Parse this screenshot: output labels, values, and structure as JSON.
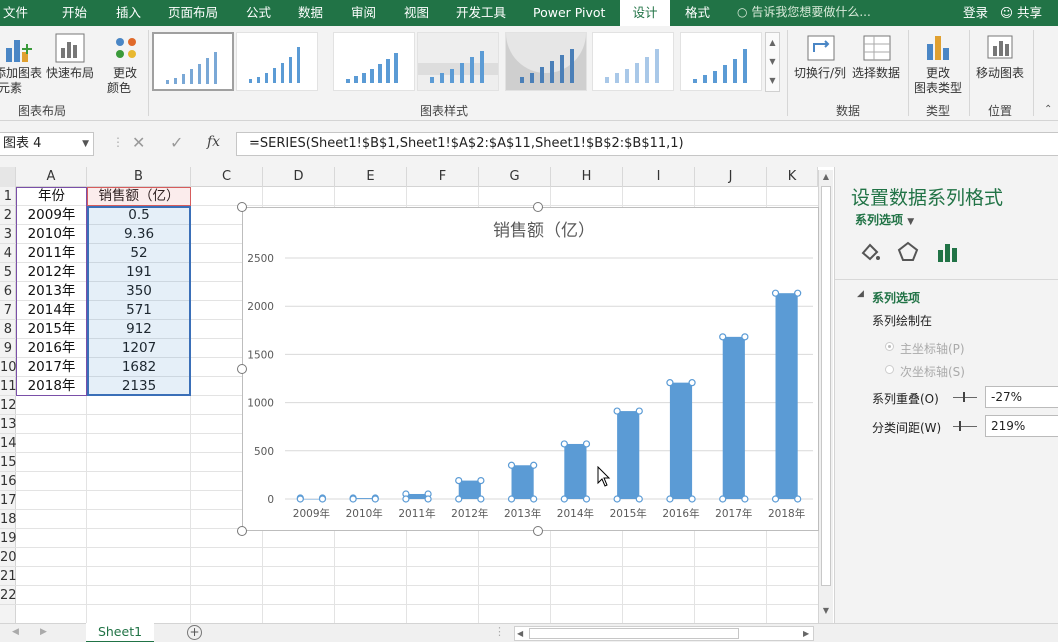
{
  "menu": {
    "items": [
      "文件",
      "开始",
      "插入",
      "页面布局",
      "公式",
      "数据",
      "审阅",
      "视图",
      "开发工具",
      "Power Pivot",
      "设计",
      "格式"
    ],
    "active": "设计",
    "tell_me": "告诉我您想要做什么...",
    "login": "登录",
    "share": "共享"
  },
  "ribbon": {
    "add_element": [
      "添加图表",
      "元素"
    ],
    "quick_layout": "快速布局",
    "change_color": [
      "更改",
      "颜色"
    ],
    "group_layout": "图表布局",
    "group_styles": "图表样式",
    "switch_rowcol": "切换行/列",
    "select_data": "选择数据",
    "group_data": "数据",
    "change_type": [
      "更改",
      "图表类型"
    ],
    "group_type": "类型",
    "move_chart": "移动图表",
    "group_location": "位置"
  },
  "formula_bar": {
    "name_box": "图表 4",
    "fx": "fx",
    "formula": "=SERIES(Sheet1!$B$1,Sheet1!$A$2:$A$11,Sheet1!$B$2:$B$11,1)"
  },
  "grid": {
    "columns": [
      "A",
      "B",
      "C",
      "D",
      "E",
      "F",
      "G",
      "H",
      "I",
      "J",
      "K"
    ],
    "rows": [
      "1",
      "2",
      "3",
      "4",
      "5",
      "6",
      "7",
      "8",
      "9",
      "10",
      "11",
      "12",
      "13",
      "14",
      "15",
      "16",
      "17",
      "18",
      "19",
      "20",
      "21",
      "22"
    ],
    "header_a": "年份",
    "header_b": "销售额（亿）",
    "data": [
      [
        "2009年",
        "0.5"
      ],
      [
        "2010年",
        "9.36"
      ],
      [
        "2011年",
        "52"
      ],
      [
        "2012年",
        "191"
      ],
      [
        "2013年",
        "350"
      ],
      [
        "2014年",
        "571"
      ],
      [
        "2015年",
        "912"
      ],
      [
        "2016年",
        "1207"
      ],
      [
        "2017年",
        "1682"
      ],
      [
        "2018年",
        "2135"
      ]
    ]
  },
  "chart_data": {
    "type": "bar",
    "title": "销售额（亿）",
    "categories": [
      "2009年",
      "2010年",
      "2011年",
      "2012年",
      "2013年",
      "2014年",
      "2015年",
      "2016年",
      "2017年",
      "2018年"
    ],
    "series": [
      {
        "name": "销售额（亿）",
        "values": [
          0.5,
          9.36,
          52,
          191,
          350,
          571,
          912,
          1207,
          1682,
          2135
        ]
      }
    ],
    "ylim": [
      0,
      2500
    ],
    "yticks": [
      0,
      500,
      1000,
      1500,
      2000,
      2500
    ],
    "grid": true,
    "legend": "none",
    "color": "#5b9bd5"
  },
  "pane": {
    "title": "设置数据系列格式",
    "options_dropdown": "系列选项",
    "section": "系列选项",
    "plot_on": "系列绘制在",
    "primary_axis": "主坐标轴(P)",
    "secondary_axis": "次坐标轴(S)",
    "overlap_label": "系列重叠(O)",
    "overlap_value": "-27%",
    "gap_label": "分类间距(W)",
    "gap_value": "219%"
  },
  "sheet_tab": "Sheet1",
  "colors": {
    "accent": "#217346",
    "bar": "#5b9bd5"
  }
}
